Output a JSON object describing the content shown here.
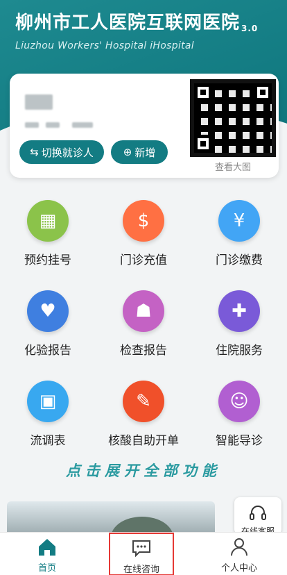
{
  "header": {
    "title": "柳州市工人医院互联网医院",
    "version": "3.0",
    "subtitle": "Liuzhou Workers' Hospital iHospital"
  },
  "patient_card": {
    "switch_button": "切换就诊人",
    "add_button": "新增",
    "qr_caption": "查看大图"
  },
  "services": [
    {
      "label": "预约挂号",
      "icon": "calendar-icon",
      "color": "#8bc34a"
    },
    {
      "label": "门诊充值",
      "icon": "invoice-icon",
      "color": "#ff7043"
    },
    {
      "label": "门诊缴费",
      "icon": "yuan-house-icon",
      "color": "#42a5f5"
    },
    {
      "label": "化验报告",
      "icon": "heart-pulse-icon",
      "color": "#3f7fe0"
    },
    {
      "label": "检查报告",
      "icon": "lungs-icon",
      "color": "#c462c4"
    },
    {
      "label": "住院服务",
      "icon": "hospital-bed-icon",
      "color": "#7a5ad8"
    },
    {
      "label": "流调表",
      "icon": "qr-code-icon",
      "color": "#38a8f0"
    },
    {
      "label": "核酸自助开单",
      "icon": "test-tube-icon",
      "color": "#f0502a"
    },
    {
      "label": "智能导诊",
      "icon": "robot-icon",
      "color": "#b15fd1"
    }
  ],
  "expand_text": "点击展开全部功能",
  "customer_service": "在线客服",
  "nav": {
    "home": "首页",
    "consult": "在线咨询",
    "profile": "个人中心"
  }
}
